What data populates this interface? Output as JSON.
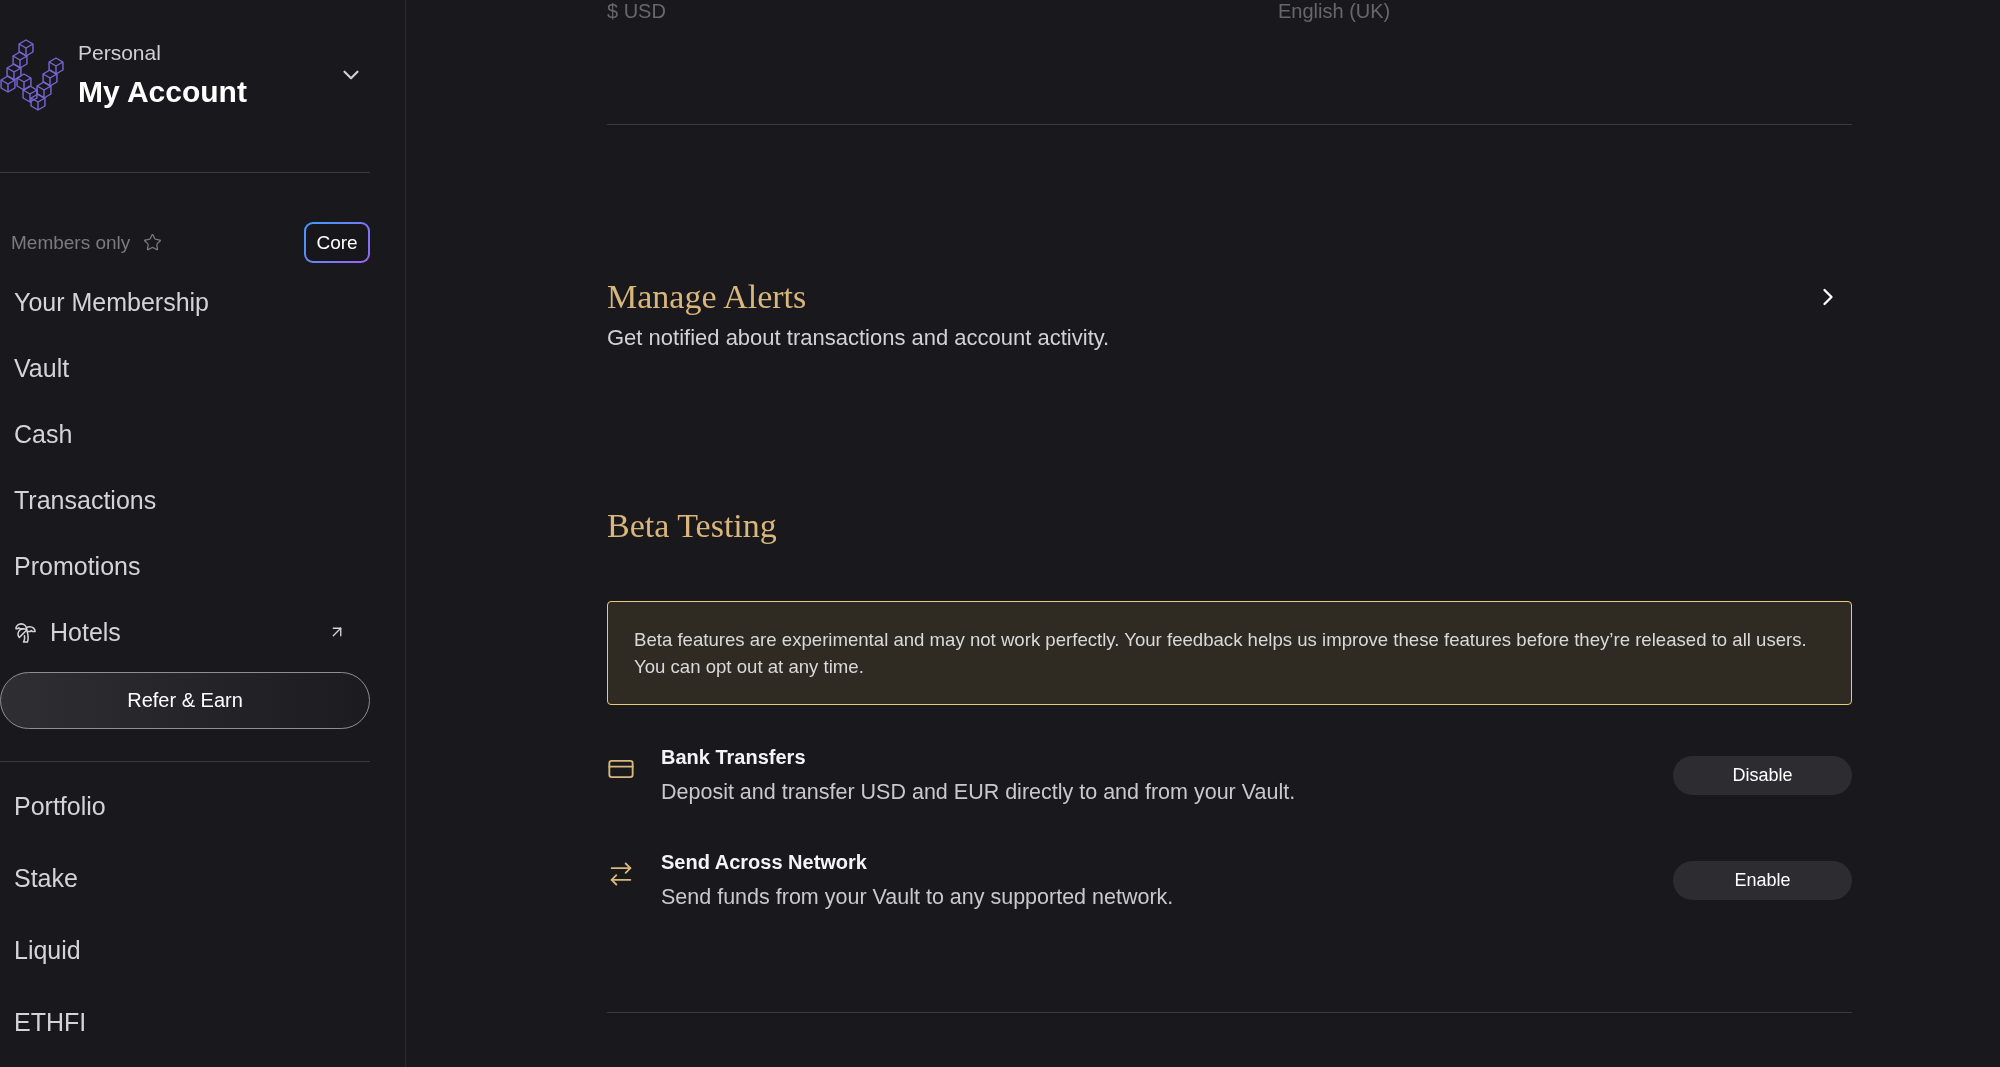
{
  "sidebar": {
    "account": {
      "type": "Personal",
      "name": "My Account"
    },
    "members": {
      "label": "Members only",
      "badge": "Core",
      "items": [
        {
          "label": "Your Membership",
          "kind": "link"
        },
        {
          "label": "Vault",
          "kind": "link"
        },
        {
          "label": "Cash",
          "kind": "link"
        },
        {
          "label": "Transactions",
          "kind": "link"
        },
        {
          "label": "Promotions",
          "kind": "link"
        },
        {
          "label": "Hotels",
          "kind": "external"
        }
      ],
      "refer_button": "Refer & Earn"
    },
    "items": [
      {
        "label": "Portfolio"
      },
      {
        "label": "Stake"
      },
      {
        "label": "Liquid"
      },
      {
        "label": "ETHFI"
      }
    ]
  },
  "main": {
    "preferences": {
      "currency": "$ USD",
      "language": "English (UK)"
    },
    "alerts": {
      "title": "Manage Alerts",
      "description": "Get notified about transactions and account activity."
    },
    "beta": {
      "title": "Beta Testing",
      "notice": "Beta features are experimental and may not work perfectly. Your feedback helps us improve these features before they’re released to all users. You can opt out at any time.",
      "features": [
        {
          "kind": "bank",
          "title": "Bank Transfers",
          "description": "Deposit and transfer USD and EUR directly to and from your Vault.",
          "action": "Disable"
        },
        {
          "kind": "network",
          "title": "Send Across Network",
          "description": "Send funds from your Vault to any supported network.",
          "action": "Enable"
        }
      ]
    }
  }
}
